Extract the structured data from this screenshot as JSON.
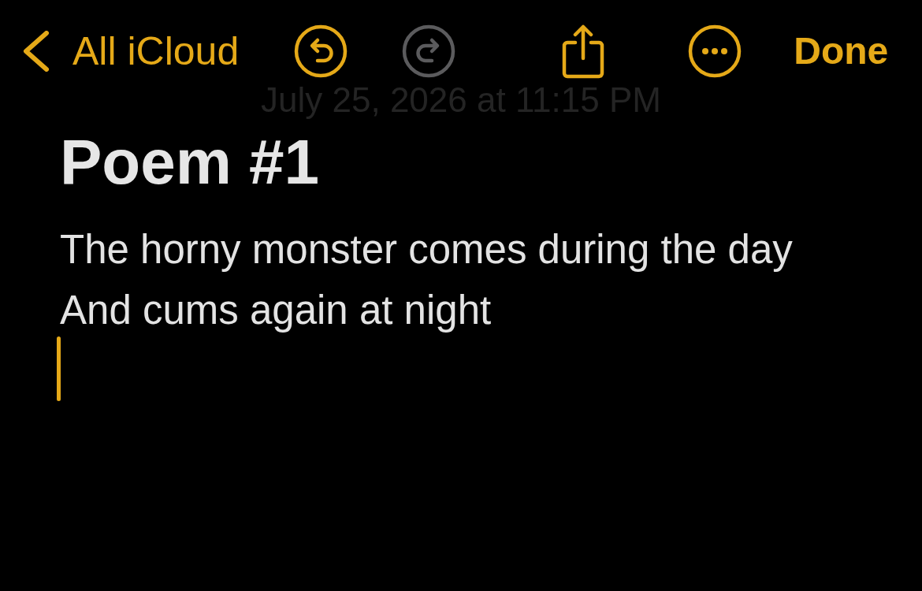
{
  "toolbar": {
    "back": {
      "label": "All iCloud"
    },
    "undo": {
      "disabled": false
    },
    "redo": {
      "disabled": true
    },
    "done": {
      "label": "Done"
    }
  },
  "note": {
    "date": "July 25, 2026 at 11:15 PM",
    "title": "Poem #1",
    "lines": [
      "The horny monster comes during the day",
      "And cums again at night"
    ],
    "editing": true
  }
}
